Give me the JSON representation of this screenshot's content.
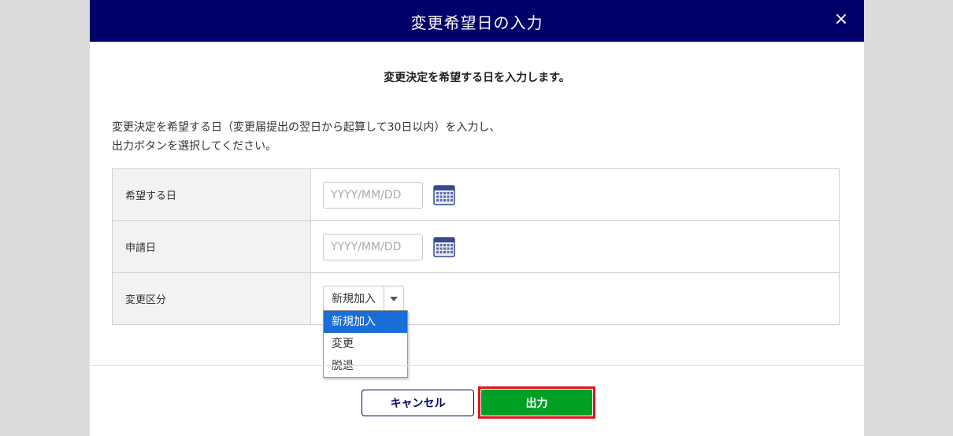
{
  "modal": {
    "title": "変更希望日の入力",
    "close_label": "×",
    "subtitle": "変更決定を希望する日を入力します。",
    "instructions": [
      "変更決定を希望する日（変更届提出の翌日から起算して30日以内）を入力し、",
      "出力ボタンを選択してください。"
    ]
  },
  "form": {
    "rows": [
      {
        "label": "希望する日",
        "placeholder": "YYYY/MM/DD",
        "icon": "calendar-icon"
      },
      {
        "label": "申請日",
        "placeholder": "YYYY/MM/DD",
        "icon": "calendar-icon"
      },
      {
        "label": "変更区分",
        "selected": "新規加入"
      }
    ],
    "dropdown_options": [
      "新規加入",
      "変更",
      "脱退"
    ]
  },
  "footer": {
    "cancel_label": "キャンセル",
    "output_label": "出力"
  },
  "colors": {
    "header_bg": "#01006a",
    "output_button": "#00a024",
    "highlight_frame": "#e0141e",
    "selected_option": "#1a6ed8"
  }
}
